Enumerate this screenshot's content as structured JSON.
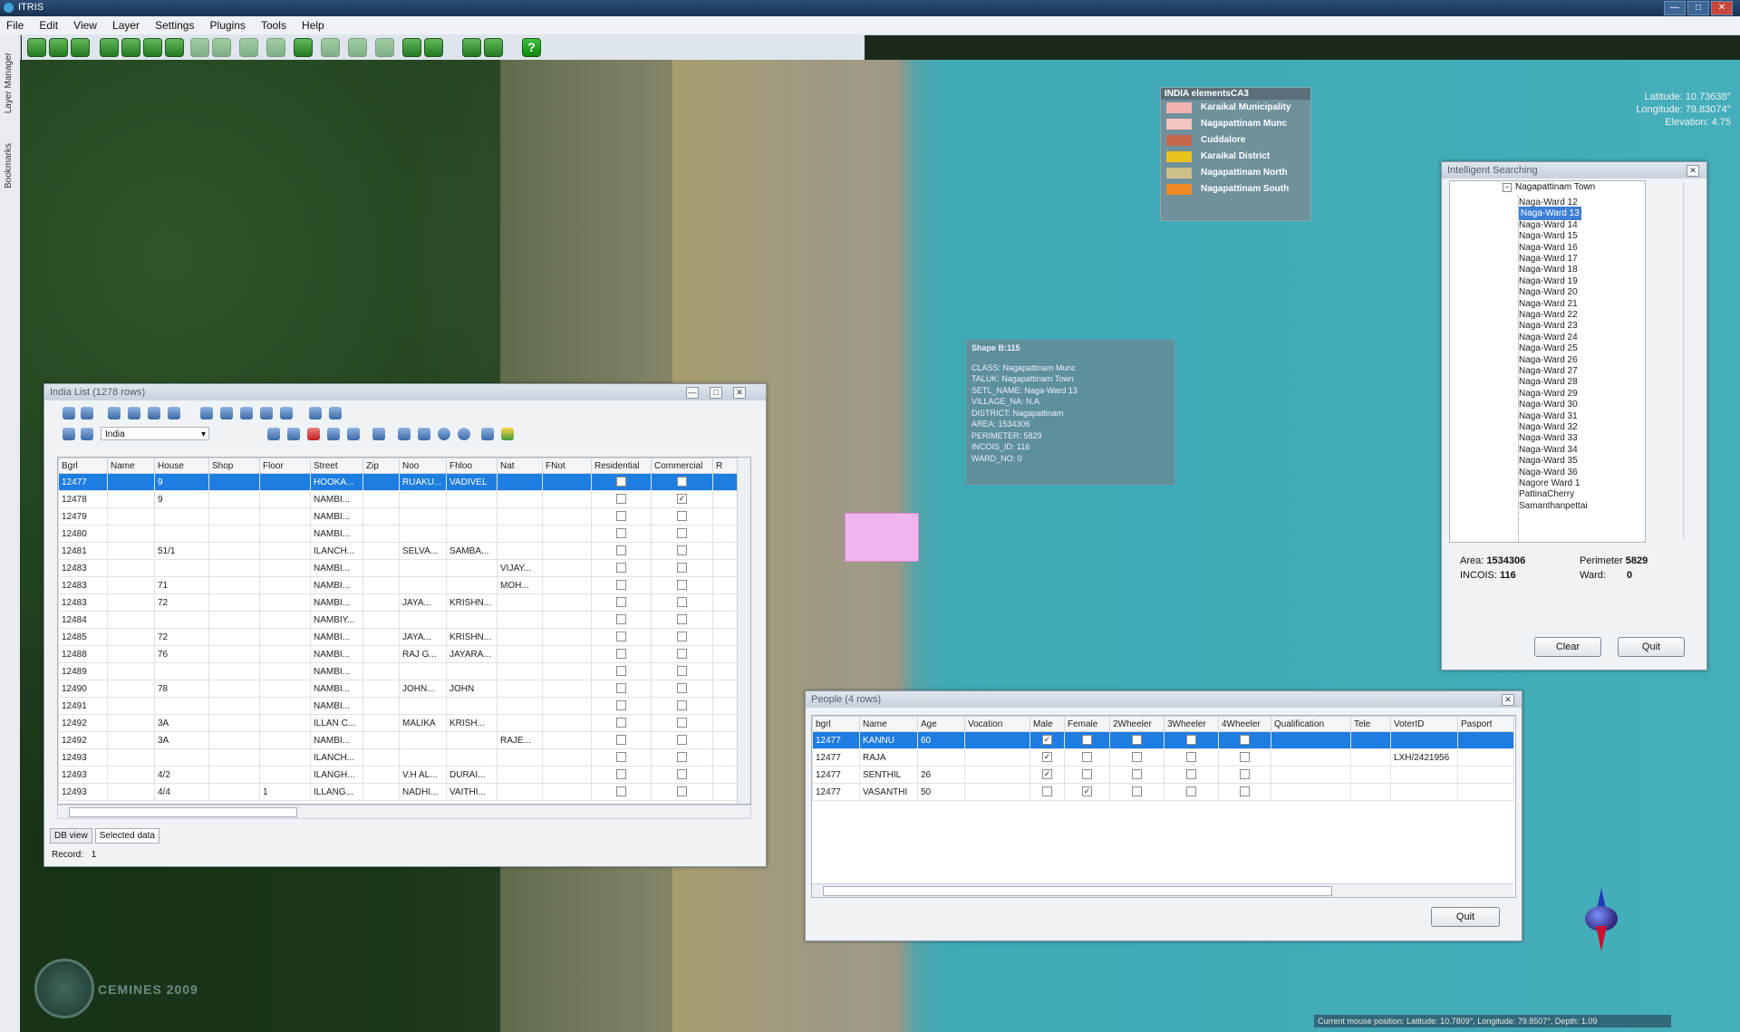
{
  "app": {
    "title": "ITRIS"
  },
  "window_controls": {
    "min": "—",
    "max": "□",
    "close": "✕"
  },
  "menu": [
    "File",
    "Edit",
    "View",
    "Layer",
    "Settings",
    "Plugins",
    "Tools",
    "Help"
  ],
  "toolbar": {
    "help_label": "?"
  },
  "left_panels": [
    "Layer Manager",
    "Bookmarks"
  ],
  "map": {
    "latitude": "Latitude: 10.73638°",
    "longitude": "Longitude: 79.83074°",
    "elevation": "Elevation: 4.75",
    "status": "Current mouse position: Latitude: 10.7809°, Longitude: 79.8507°, Depth: 1.09",
    "logo_text": "CEMINES 2009"
  },
  "legend": {
    "title": "INDIA elementsCA3",
    "items": [
      {
        "label": "Karaikal Municipality",
        "color": "#f0b3b0"
      },
      {
        "label": "Nagapattinam Munc",
        "color": "#f3c4c2"
      },
      {
        "label": "Cuddalore",
        "color": "#c9674a"
      },
      {
        "label": "Karaikal District",
        "color": "#e9c41e"
      },
      {
        "label": "Nagapattinam North",
        "color": "#cdbf8a"
      },
      {
        "label": "Nagapattinam South",
        "color": "#ef8a27"
      }
    ]
  },
  "shape_info": {
    "title": "Shape B:115",
    "lines": [
      "CLASS: Nagapattinam Munc",
      "TALUK: Nagapattinam Town",
      "SETL_NAME: Naga-Ward 13",
      "VILLAGE_NA: N.A",
      "DISTRICT: Nagapattinam",
      "AREA: 1534306",
      "PERIMETER: 5829",
      "INCOIS_ID: 116",
      "WARD_NO: 0"
    ]
  },
  "india_list": {
    "title": "India List (1278 rows)",
    "filter_value": "India",
    "columns": [
      "Bgrl",
      "Name",
      "House",
      "Shop",
      "Floor",
      "Street",
      "Zip",
      "Noo",
      "Fhloo",
      "Nat",
      "FNot",
      "Residential",
      "Commercial",
      "R"
    ],
    "rows": [
      {
        "cells": [
          "12477",
          "",
          "9",
          "",
          "",
          "HOOKA...",
          "",
          "RUAKU...",
          "VADIVEL",
          "",
          ""
        ],
        "res": false,
        "com": false
      },
      {
        "cells": [
          "12478",
          "",
          "9",
          "",
          "",
          "NAMBI...",
          "",
          "",
          "",
          "",
          ""
        ],
        "res": false,
        "com": true
      },
      {
        "cells": [
          "12479",
          "",
          "",
          "",
          "",
          "NAMBI...",
          "",
          "",
          "",
          "",
          ""
        ],
        "res": false,
        "com": false
      },
      {
        "cells": [
          "12480",
          "",
          "",
          "",
          "",
          "NAMBI...",
          "",
          "",
          "",
          "",
          ""
        ],
        "res": false,
        "com": false
      },
      {
        "cells": [
          "12481",
          "",
          "51/1",
          "",
          "",
          "ILANCH...",
          "",
          "SELVA...",
          "SAMBA...",
          "",
          ""
        ],
        "res": false,
        "com": false
      },
      {
        "cells": [
          "12483",
          "",
          "",
          "",
          "",
          "NAMBI...",
          "",
          "",
          "",
          "VIJAY...",
          ""
        ],
        "res": false,
        "com": false
      },
      {
        "cells": [
          "12483",
          "",
          "71",
          "",
          "",
          "NAMBI...",
          "",
          "",
          "",
          "MOH...",
          ""
        ],
        "res": false,
        "com": false
      },
      {
        "cells": [
          "12483",
          "",
          "72",
          "",
          "",
          "NAMBI...",
          "",
          "JAYA...",
          "KRISHN...",
          "",
          ""
        ],
        "res": false,
        "com": false
      },
      {
        "cells": [
          "12484",
          "",
          "",
          "",
          "",
          "NAMBIY...",
          "",
          "",
          "",
          "",
          ""
        ],
        "res": false,
        "com": false
      },
      {
        "cells": [
          "12485",
          "",
          "72",
          "",
          "",
          "NAMBI...",
          "",
          "JAYA...",
          "KRISHN...",
          "",
          ""
        ],
        "res": false,
        "com": false
      },
      {
        "cells": [
          "12488",
          "",
          "76",
          "",
          "",
          "NAMBI...",
          "",
          "RAJ G...",
          "JAYARA...",
          "",
          ""
        ],
        "res": false,
        "com": false
      },
      {
        "cells": [
          "12489",
          "",
          "",
          "",
          "",
          "NAMBI...",
          "",
          "",
          "",
          "",
          ""
        ],
        "res": false,
        "com": false
      },
      {
        "cells": [
          "12490",
          "",
          "78",
          "",
          "",
          "NAMBI...",
          "",
          "JOHN...",
          "JOHN",
          "",
          ""
        ],
        "res": false,
        "com": false
      },
      {
        "cells": [
          "12491",
          "",
          "",
          "",
          "",
          "NAMBI...",
          "",
          "",
          "",
          "",
          ""
        ],
        "res": false,
        "com": false
      },
      {
        "cells": [
          "12492",
          "",
          "3A",
          "",
          "",
          "ILLAN C...",
          "",
          "MALIKA",
          "KRISH...",
          "",
          ""
        ],
        "res": false,
        "com": false
      },
      {
        "cells": [
          "12492",
          "",
          "3A",
          "",
          "",
          "NAMBI...",
          "",
          "",
          "",
          "RAJE...",
          ""
        ],
        "res": false,
        "com": false
      },
      {
        "cells": [
          "12493",
          "",
          "",
          "",
          "",
          "ILANCH...",
          "",
          "",
          "",
          "",
          ""
        ],
        "res": false,
        "com": false
      },
      {
        "cells": [
          "12493",
          "",
          "4/2",
          "",
          "",
          "ILANGH...",
          "",
          "V.H AL...",
          "DURAI...",
          "",
          ""
        ],
        "res": false,
        "com": false
      },
      {
        "cells": [
          "12493",
          "",
          "4/4",
          "",
          "1",
          "ILLANG...",
          "",
          "NADHI...",
          "VAITHI...",
          "",
          ""
        ],
        "res": false,
        "com": false
      }
    ],
    "tabs": [
      "DB view",
      "Selected data"
    ],
    "record_label": "Record:",
    "record_value": "1"
  },
  "people": {
    "title": "People (4 rows)",
    "columns": [
      "bgrl",
      "Name",
      "Age",
      "Vocation",
      "Male",
      "Female",
      "2Wheeler",
      "3Wheeler",
      "4Wheeler",
      "Qualification",
      "Tele",
      "VoterID",
      "Pasport"
    ],
    "rows": [
      {
        "bgrl": "12477",
        "name": "KANNU",
        "age": "60",
        "vocation": "",
        "male": true,
        "female": false,
        "w2": false,
        "w3": false,
        "w4": false,
        "qual": "",
        "tele": "",
        "voter": "",
        "pass": ""
      },
      {
        "bgrl": "12477",
        "name": "RAJA",
        "age": "",
        "vocation": "",
        "male": true,
        "female": false,
        "w2": false,
        "w3": false,
        "w4": false,
        "qual": "",
        "tele": "",
        "voter": "LXH/2421956",
        "pass": ""
      },
      {
        "bgrl": "12477",
        "name": "SENTHIL",
        "age": "26",
        "vocation": "",
        "male": true,
        "female": false,
        "w2": false,
        "w3": false,
        "w4": false,
        "qual": "",
        "tele": "",
        "voter": "",
        "pass": ""
      },
      {
        "bgrl": "12477",
        "name": "VASANTHI",
        "age": "50",
        "vocation": "",
        "male": false,
        "female": true,
        "w2": false,
        "w3": false,
        "w4": false,
        "qual": "",
        "tele": "",
        "voter": "",
        "pass": ""
      }
    ],
    "quit_label": "Quit"
  },
  "intelligent_search": {
    "title": "Intelligent Searching",
    "root": "Nagapattinam Town",
    "nodes": [
      "Naga-Ward 12",
      "Naga-Ward 13",
      "Naga-Ward 14",
      "Naga-Ward 15",
      "Naga-Ward 16",
      "Naga-Ward 17",
      "Naga-Ward 18",
      "Naga-Ward 19",
      "Naga-Ward 20",
      "Naga-Ward 21",
      "Naga-Ward 22",
      "Naga-Ward 23",
      "Naga-Ward 24",
      "Naga-Ward 25",
      "Naga-Ward 26",
      "Naga-Ward 27",
      "Naga-Ward 28",
      "Naga-Ward 29",
      "Naga-Ward 30",
      "Naga-Ward 31",
      "Naga-Ward 32",
      "Naga-Ward 33",
      "Naga-Ward 34",
      "Naga-Ward 35",
      "Naga-Ward 36",
      "Nagore Ward 1",
      "PattinaCherry",
      "Samanthanpettai"
    ],
    "selected_index": 1,
    "area_label": "Area:",
    "area_value": "1534306",
    "perimeter_label": "Perimeter",
    "perimeter_value": "5829",
    "incois_label": "INCOIS:",
    "incois_value": "116",
    "ward_label": "Ward:",
    "ward_value": "0",
    "clear_label": "Clear",
    "quit_label": "Quit"
  }
}
